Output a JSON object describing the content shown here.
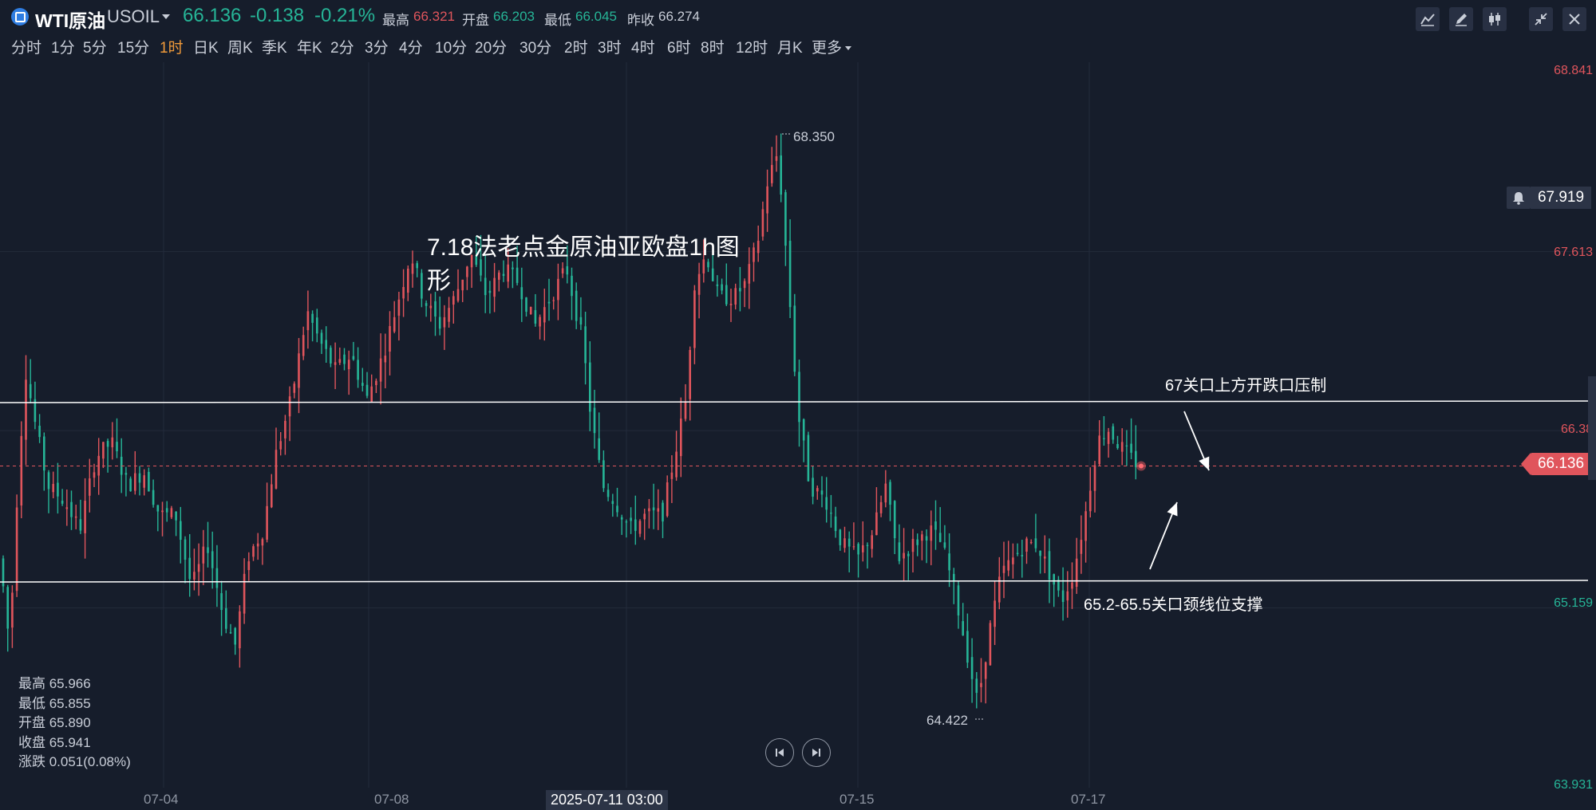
{
  "header": {
    "symbol_name": "WTI原油",
    "symbol_code": "USOIL",
    "last_price": "66.136",
    "change": "-0.138",
    "change_pct": "-0.21%",
    "high_label": "最高",
    "high_value": "66.321",
    "open_label": "开盘",
    "open_value": "66.203",
    "low_label": "最低",
    "low_value": "66.045",
    "prev_close_label": "昨收",
    "prev_close_value": "66.274",
    "toolbar_icons": [
      "line-tool-icon",
      "draw-pen-icon",
      "candlestick-icon",
      "collapse-icon",
      "close-icon"
    ]
  },
  "periods": [
    "分时",
    "1分",
    "5分",
    "15分",
    "1时",
    "日K",
    "周K",
    "季K",
    "年K",
    "2分",
    "3分",
    "4分",
    "10分",
    "20分",
    "30分",
    "2时",
    "3时",
    "4时",
    "6时",
    "8时",
    "12时",
    "月K",
    "更多"
  ],
  "active_period": "1时",
  "price_axis": {
    "top": "68.841",
    "level2": "67.613",
    "level3": "66.38",
    "level4": "65.159",
    "bottom": "63.931"
  },
  "date_axis": [
    "07-04",
    "07-08",
    "07-15",
    "07-17"
  ],
  "crosshair_date": "2025-07-11 03:00",
  "current_price_tag": "66.136",
  "alert_price": "67.919",
  "chart_data": {
    "type": "candlestick",
    "symbol": "USOIL",
    "interval": "1h",
    "ylim": [
      63.931,
      68.841
    ],
    "high_marker": "68.350",
    "low_marker": "64.422",
    "resistance_line": 66.98,
    "support_line": 65.5,
    "last_price": 66.136
  },
  "annotations": {
    "title": "7.18法老点金原油亚欧盘1h图形",
    "resistance": "67关口上方开跌口压制",
    "support": "65.2-65.5关口颈线位支撑"
  },
  "ohlc": {
    "high": "最高 65.966",
    "low": "最低 65.855",
    "open": "开盘 65.890",
    "close": "收盘 65.941",
    "change": "涨跌 0.051(0.08%)"
  },
  "colors": {
    "up": "#e0555c",
    "down": "#26b597",
    "background": "#161d2b",
    "active_period": "#f09a3a"
  }
}
